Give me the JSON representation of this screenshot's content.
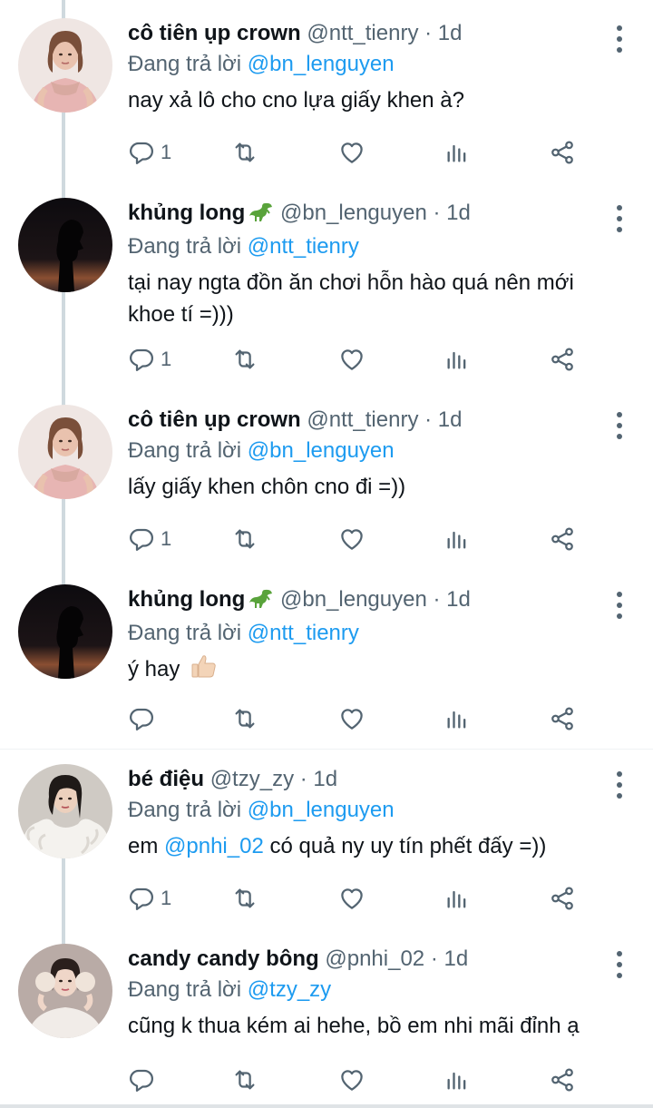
{
  "colors": {
    "accent": "#1d9bf0",
    "muted": "#536471",
    "text": "#0f1419",
    "thread": "#cfd9de"
  },
  "tweets": [
    {
      "name": "cô tiên ụp crown",
      "emoji": "",
      "handle": "@ntt_tienry",
      "dot": "·",
      "time": "1d",
      "reply_prefix": "Đang trả lời",
      "reply_to": "@bn_lenguyen",
      "text": "nay xả lô cho cno lựa giấy khen à?",
      "reply_count": "1",
      "avatar": "woman-pink-dress"
    },
    {
      "name": "khủng long",
      "emoji": "dinosaur",
      "handle": "@bn_lenguyen",
      "dot": "·",
      "time": "1d",
      "reply_prefix": "Đang trả lời",
      "reply_to": "@ntt_tienry",
      "text": "tại nay ngta đồn ăn chơi hỗn hào quá nên mới khoe tí =)))",
      "reply_count": "1",
      "avatar": "silhouette-sunset"
    },
    {
      "name": "cô tiên ụp crown",
      "emoji": "",
      "handle": "@ntt_tienry",
      "dot": "·",
      "time": "1d",
      "reply_prefix": "Đang trả lời",
      "reply_to": "@bn_lenguyen",
      "text": "lấy giấy khen chôn cno đi =))",
      "reply_count": "1",
      "avatar": "woman-pink-dress"
    },
    {
      "name": "khủng long",
      "emoji": "dinosaur",
      "handle": "@bn_lenguyen",
      "dot": "·",
      "time": "1d",
      "reply_prefix": "Đang trả lời",
      "reply_to": "@ntt_tienry",
      "text_before": "ý hay",
      "text_emoji": "thumbs-up",
      "reply_count": "",
      "avatar": "silhouette-sunset"
    },
    {
      "name": "bé điệu",
      "emoji": "",
      "handle": "@tzy_zy",
      "dot": "·",
      "time": "1d",
      "reply_prefix": "Đang trả lời",
      "reply_to": "@bn_lenguyen",
      "text_before": "em",
      "text_mention": "@pnhi_02",
      "text_after": "có quả ny uy tín phết đấy =))",
      "reply_count": "1",
      "avatar": "woman-fur-coat"
    },
    {
      "name": "candy candy bông",
      "emoji": "",
      "handle": "@pnhi_02",
      "dot": "·",
      "time": "1d",
      "reply_prefix": "Đang trả lời",
      "reply_to": "@tzy_zy",
      "text": "cũng k thua kém ai hehe, bồ em nhi mãi đỉnh ạ",
      "reply_count": "",
      "avatar": "woman-earmuffs"
    }
  ],
  "icons": {
    "reply": "reply-icon",
    "retweet": "retweet-icon",
    "like": "heart-icon",
    "views": "views-icon",
    "share": "share-icon",
    "more": "more-icon"
  }
}
